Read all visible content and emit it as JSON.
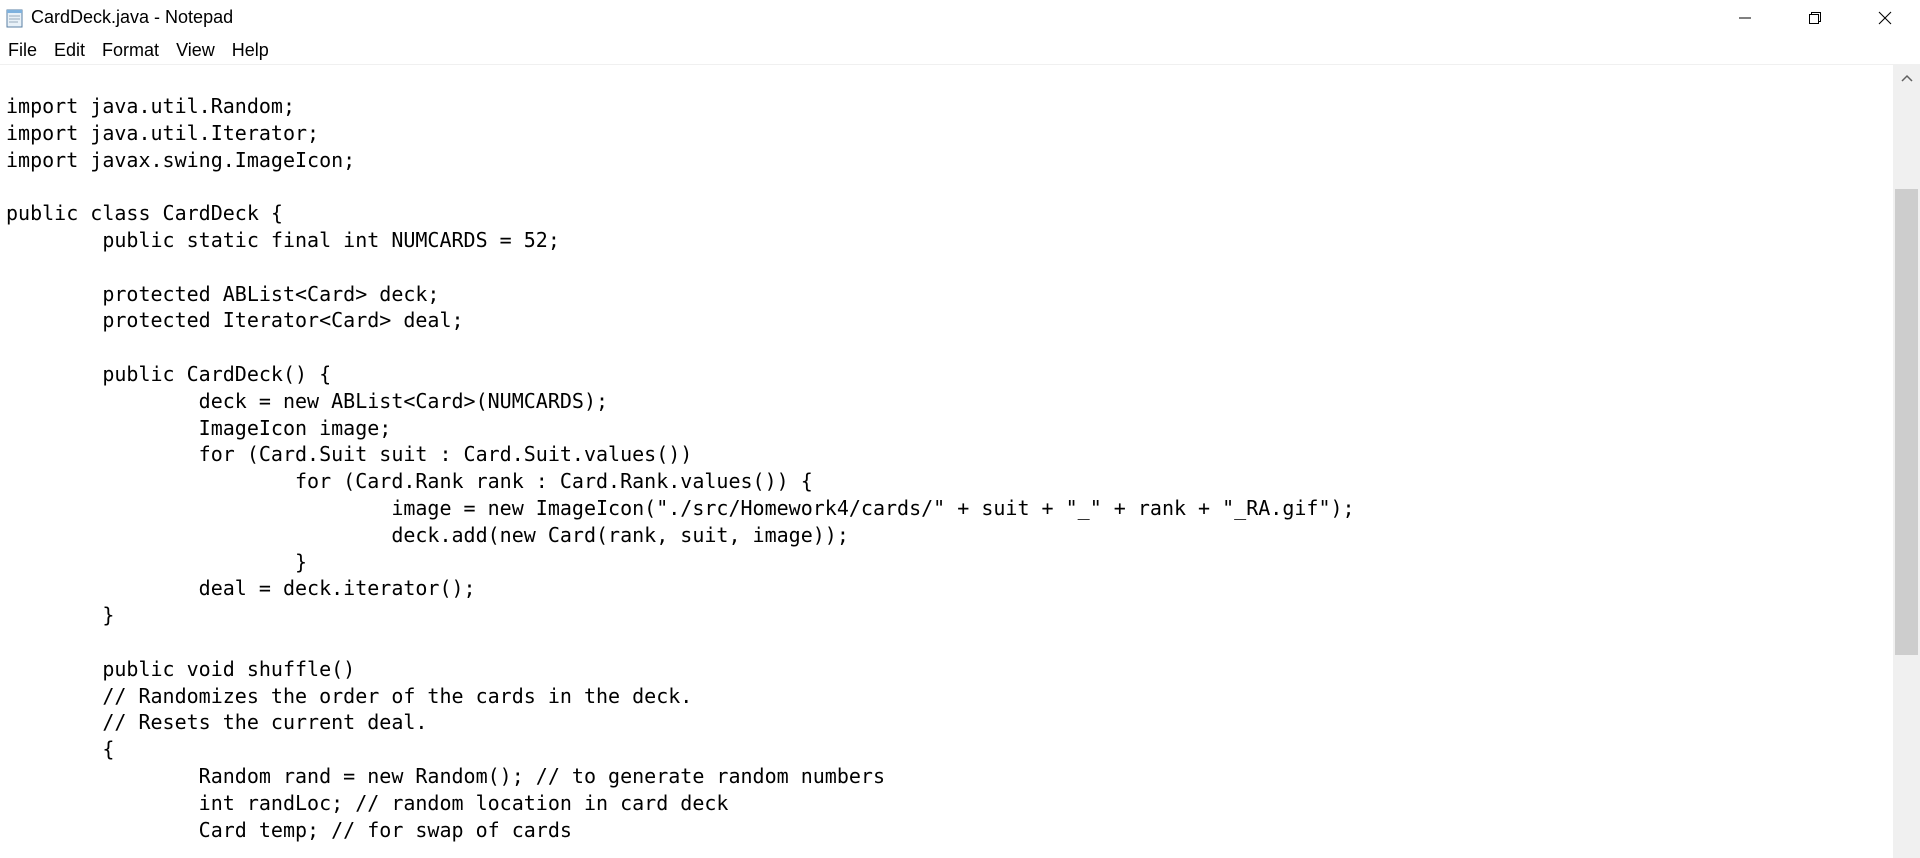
{
  "window": {
    "title": "CardDeck.java - Notepad",
    "icons": {
      "app": "notepad-icon",
      "minimize": "minimize-icon",
      "maximize": "restore-icon",
      "close": "close-icon",
      "scroll_up": "chevron-up-icon"
    }
  },
  "menu": {
    "items": [
      {
        "label": "File"
      },
      {
        "label": "Edit"
      },
      {
        "label": "Format"
      },
      {
        "label": "View"
      },
      {
        "label": "Help"
      }
    ]
  },
  "editor": {
    "lines": [
      "import java.util.Random;",
      "import java.util.Iterator;",
      "import javax.swing.ImageIcon;",
      "",
      "public class CardDeck {",
      "\tpublic static final int NUMCARDS = 52;",
      "",
      "\tprotected ABList<Card> deck;",
      "\tprotected Iterator<Card> deal;",
      "",
      "\tpublic CardDeck() {",
      "\t\tdeck = new ABList<Card>(NUMCARDS);",
      "\t\tImageIcon image;",
      "\t\tfor (Card.Suit suit : Card.Suit.values())",
      "\t\t\tfor (Card.Rank rank : Card.Rank.values()) {",
      "\t\t\t\timage = new ImageIcon(\"./src/Homework4/cards/\" + suit + \"_\" + rank + \"_RA.gif\");",
      "\t\t\t\tdeck.add(new Card(rank, suit, image));",
      "\t\t\t}",
      "\t\tdeal = deck.iterator();",
      "\t}",
      "",
      "\tpublic void shuffle()",
      "\t// Randomizes the order of the cards in the deck.",
      "\t// Resets the current deal.",
      "\t{",
      "\t\tRandom rand = new Random(); // to generate random numbers",
      "\t\tint randLoc; // random location in card deck",
      "\t\tCard temp; // for swap of cards"
    ]
  },
  "colors": {
    "background": "#ffffff",
    "text": "#000000",
    "scrollbar_track": "#f0f0f0",
    "scrollbar_thumb": "#cdcdcd"
  }
}
